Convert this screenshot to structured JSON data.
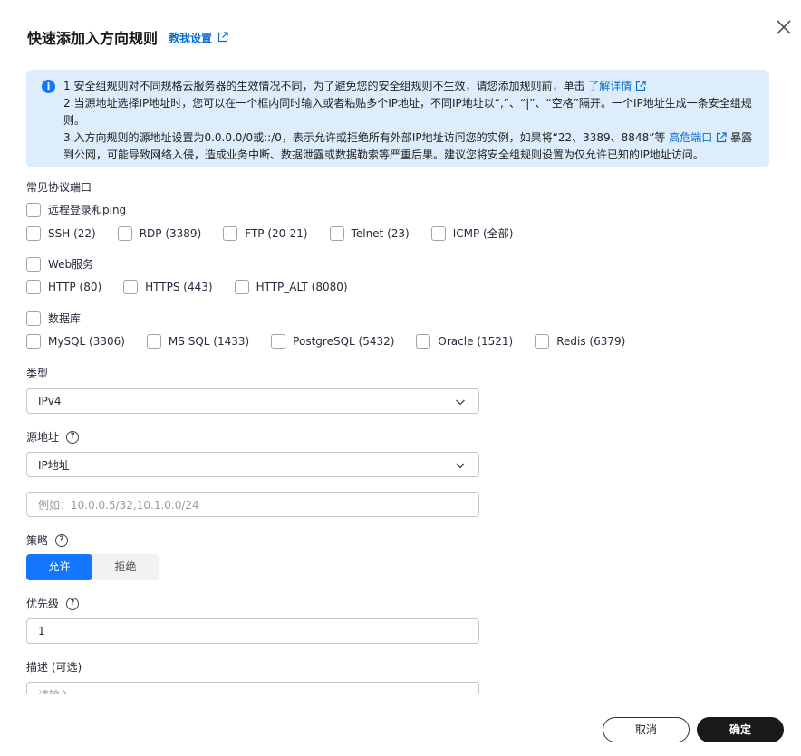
{
  "dialog": {
    "title": "快速添加入方向规则",
    "tutorial_link": "教我设置",
    "cancel": "取消",
    "confirm": "确定"
  },
  "info": {
    "line1_text": "1.安全组规则对不同规格云服务器的生效情况不同，为了避免您的安全组规则不生效，请您添加规则前，单击",
    "line1_link": "了解详情",
    "line2_text": "2.当源地址选择IP地址时，您可以在一个框内同时输入或者粘贴多个IP地址，不同IP地址以“,”、“|”、“空格”隔开。一个IP地址生成一条安全组规则。",
    "line3_text_a": "3.入方向规则的源地址设置为0.0.0.0/0或::/0，表示允许或拒绝所有外部IP地址访问您的实例，如果将“22、3389、8848”等",
    "line3_link": "高危端口",
    "line3_text_b": "暴露到公网，可能导致网络入侵，造成业务中断、数据泄露或数据勒索等严重后果。建议您将安全组规则设置为仅允许已知的IP地址访问。"
  },
  "ports": {
    "label": "常见协议端口",
    "remote_group": "远程登录和ping",
    "remote_items": [
      "SSH (22)",
      "RDP (3389)",
      "FTP (20-21)",
      "Telnet (23)",
      "ICMP (全部)"
    ],
    "web_group": "Web服务",
    "web_items": [
      "HTTP (80)",
      "HTTPS (443)",
      "HTTP_ALT (8080)"
    ],
    "db_group": "数据库",
    "db_items": [
      "MySQL (3306)",
      "MS SQL (1433)",
      "PostgreSQL (5432)",
      "Oracle (1521)",
      "Redis (6379)"
    ]
  },
  "type": {
    "label": "类型",
    "value": "IPv4"
  },
  "source": {
    "label": "源地址",
    "value": "IP地址",
    "ip_placeholder": "例如：10.0.0.5/32,10.1.0.0/24"
  },
  "policy": {
    "label": "策略",
    "allow": "允许",
    "deny": "拒绝"
  },
  "priority": {
    "label": "优先级",
    "value": "1"
  },
  "description": {
    "label": "描述 (可选)",
    "placeholder": "请输入"
  }
}
